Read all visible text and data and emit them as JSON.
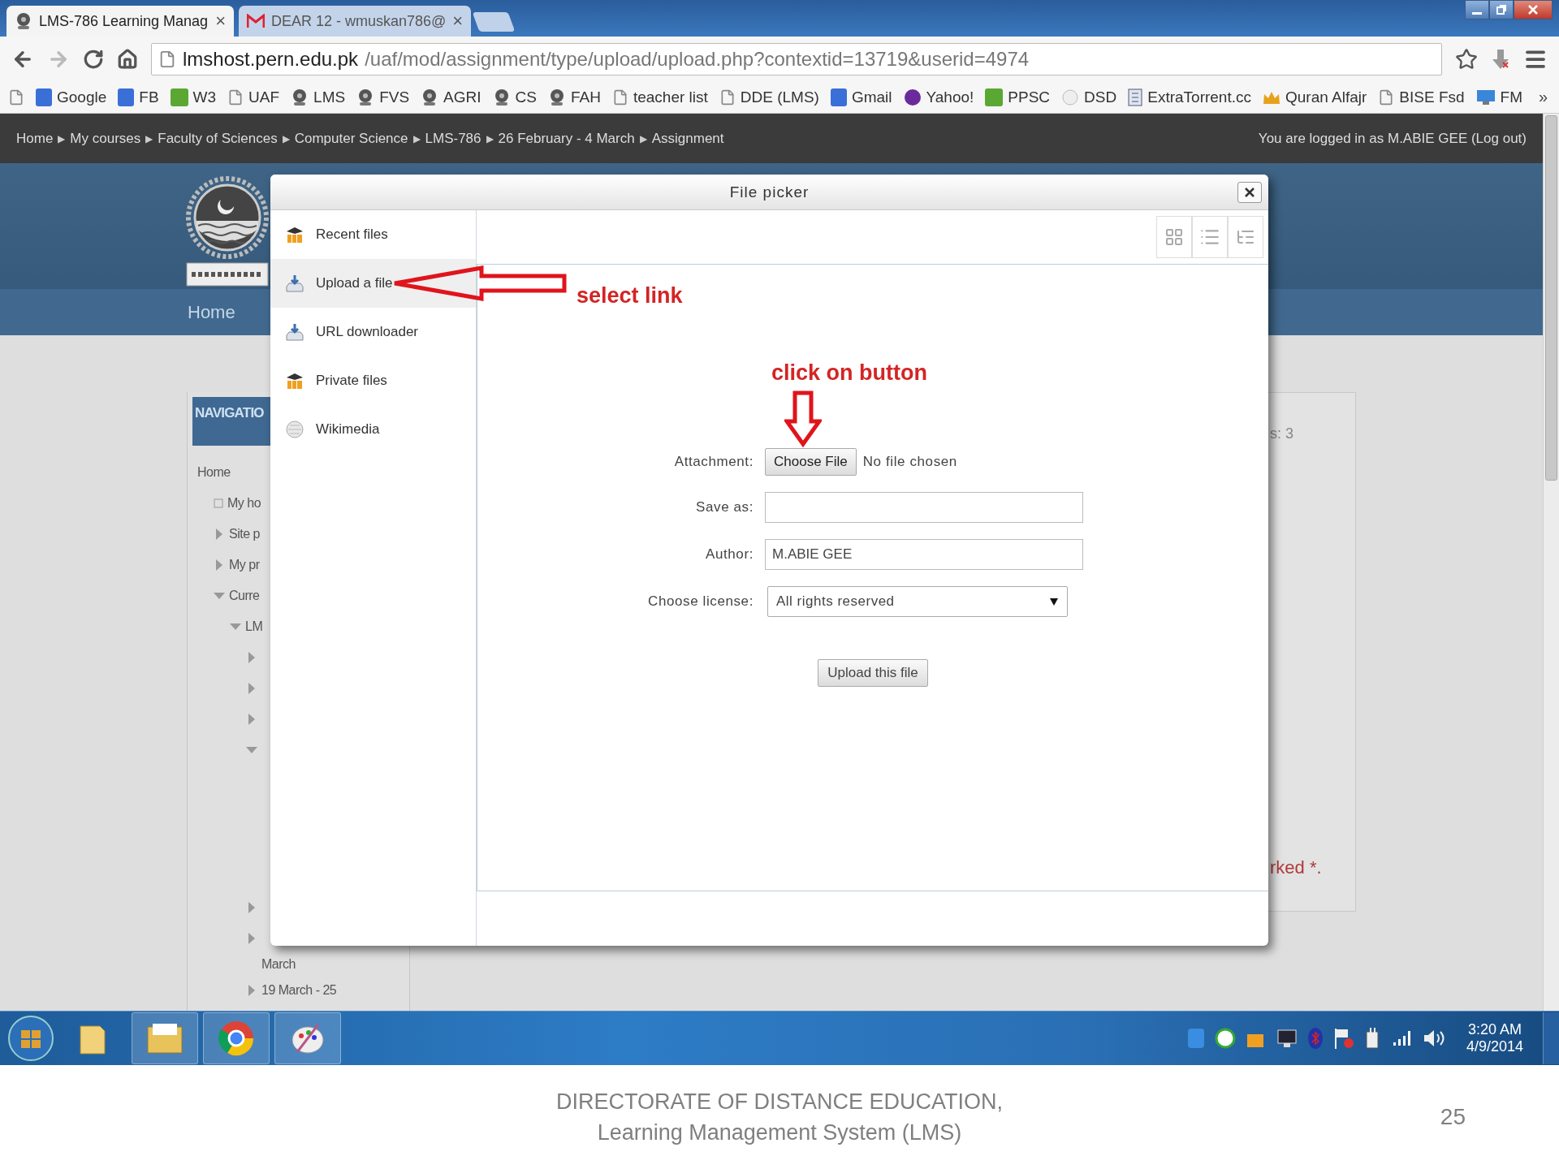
{
  "browser": {
    "tabs": [
      {
        "title": "LMS-786 Learning Manag",
        "close": "×",
        "selected": true
      },
      {
        "title": "DEAR 12 - wmuskan786@",
        "close": "×",
        "selected": false
      }
    ],
    "address": {
      "host": "lmshost.pern.edu.pk",
      "path": "/uaf/mod/assignment/type/upload/upload.php?contextid=13719&userid=4974"
    },
    "bookmarks": [
      {
        "label": "Google"
      },
      {
        "label": "FB"
      },
      {
        "label": "W3"
      },
      {
        "label": "UAF"
      },
      {
        "label": "LMS"
      },
      {
        "label": "FVS"
      },
      {
        "label": "AGRI"
      },
      {
        "label": "CS"
      },
      {
        "label": "FAH"
      },
      {
        "label": "teacher list"
      },
      {
        "label": "DDE (LMS)"
      },
      {
        "label": "Gmail"
      },
      {
        "label": "Yahoo!"
      },
      {
        "label": "PPSC"
      },
      {
        "label": "DSD"
      },
      {
        "label": "ExtraTorrent.cc"
      },
      {
        "label": "Quran Alfajr"
      },
      {
        "label": "BISE Fsd"
      },
      {
        "label": "FM"
      }
    ],
    "bookmarks_more": "»"
  },
  "breadcrumb": {
    "separator": "▶",
    "items": [
      "Home",
      "My courses",
      "Faculty of Sciences",
      "Computer Science",
      "LMS-786",
      "26 February - 4 March",
      "Assignment"
    ]
  },
  "login": {
    "text": "You are logged in as M.ABIE GEE",
    "link": "(Log out)"
  },
  "header": {
    "nav_link": "Home"
  },
  "navigation": {
    "title": "NAVIGATIO",
    "tree": [
      {
        "label": "Home",
        "kind": "root",
        "children": [
          {
            "label": "My ho",
            "kind": "leaf"
          },
          {
            "label": "Site p",
            "kind": "branch",
            "expanded": false
          },
          {
            "label": "My pr",
            "kind": "branch",
            "expanded": false
          },
          {
            "label": "Curre",
            "kind": "branch",
            "expanded": true,
            "children": [
              {
                "label": "LM",
                "kind": "branch",
                "expanded": true,
                "children": [
                  {
                    "kind": "branch",
                    "expanded": false
                  },
                  {
                    "kind": "branch",
                    "expanded": false
                  },
                  {
                    "kind": "branch",
                    "expanded": false
                  },
                  {
                    "kind": "branch",
                    "expanded": true
                  },
                  {
                    "kind": "branch",
                    "expanded": false
                  },
                  {
                    "label": "March",
                    "kind": "wrapped",
                    "expanded": false
                  },
                  {
                    "label": "19 March - 25",
                    "kind": "branch",
                    "expanded": false
                  }
                ]
              }
            ]
          }
        ]
      }
    ]
  },
  "side_block": {
    "top_text": "s: 3",
    "bottom_text": "rked *."
  },
  "file_picker": {
    "title": "File picker",
    "repositories": [
      {
        "label": "Recent files",
        "selected": false
      },
      {
        "label": "Upload a file",
        "selected": true
      },
      {
        "label": "URL downloader",
        "selected": false
      },
      {
        "label": "Private files",
        "selected": false
      },
      {
        "label": "Wikimedia",
        "selected": false
      }
    ],
    "form": {
      "attachment": {
        "label": "Attachment:",
        "button": "Choose File",
        "status": "No file chosen"
      },
      "save_as": {
        "label": "Save as:"
      },
      "author": {
        "label": "Author:",
        "value": "M.ABIE GEE"
      },
      "license": {
        "label": "Choose license:",
        "value": "All rights reserved"
      },
      "submit": "Upload this file"
    }
  },
  "annotations": [
    {
      "kind": "left-arrow",
      "text": "select link"
    },
    {
      "kind": "down-arrow",
      "text": "click on button"
    }
  ],
  "taskbar": {
    "time": "3:20 AM",
    "date": "4/9/2014"
  },
  "slide_footer": {
    "lines": [
      "DIRECTORATE OF DISTANCE EDUCATION,",
      "Learning Management System (LMS)"
    ],
    "page_number": "25"
  }
}
